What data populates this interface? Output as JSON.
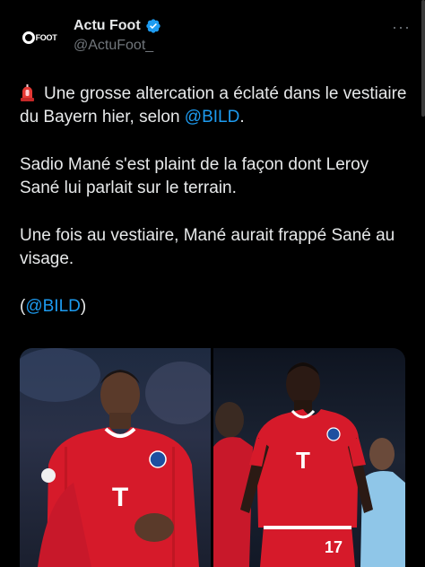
{
  "author": {
    "display_name": "Actu Foot",
    "handle": "@ActuFoot_",
    "avatar_text": "FOOT"
  },
  "icons": {
    "verified": "verified-badge-icon",
    "more": "more-options-icon",
    "siren": "siren-emoji-icon"
  },
  "colors": {
    "background": "#000000",
    "text": "#e7e9ea",
    "secondary": "#71767b",
    "accent": "#1d9bf0",
    "jersey_red": "#d61a2a"
  },
  "tweet": {
    "p1_text": "Une grosse altercation a éclaté dans le vestiaire du Bayern hier, selon ",
    "p1_mention": "@BILD",
    "p1_end": ".",
    "p2": "Sadio Mané s'est plaint de la façon dont Leroy Sané lui parlait sur le terrain.",
    "p3": "Une fois au vestiaire, Mané aurait frappé Sané au visage.",
    "p4_open": "(",
    "p4_mention": "@BILD",
    "p4_close": ")"
  },
  "media": {
    "left_photo": "Bayern player in red jersey clapping",
    "right_photo": "Bayern player number 17 in red jersey",
    "jersey_sponsor": "T",
    "jersey_number": "17"
  }
}
